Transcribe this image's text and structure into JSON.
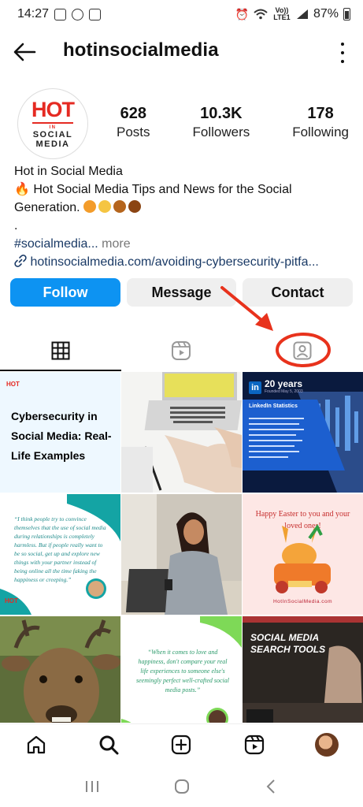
{
  "status_bar": {
    "time": "14:27",
    "network_label": "Vo)) LTE1",
    "battery": "87%"
  },
  "header": {
    "username": "hotinsocialmedia",
    "back_icon": "arrow-left-icon",
    "menu_icon": "kebab-menu-icon"
  },
  "profile": {
    "avatar_logo": {
      "line1": "HOT",
      "line2": "IN",
      "line3": "SOCIAL",
      "line4": "MEDIA"
    },
    "stats": [
      {
        "value": "628",
        "label": "Posts"
      },
      {
        "value": "10.3K",
        "label": "Followers"
      },
      {
        "value": "178",
        "label": "Following"
      }
    ],
    "bio": {
      "name": "Hot in Social Media",
      "line1": "Hot Social Media Tips and News for the Social",
      "line2": "Generation.",
      "line3": ".",
      "hashtag": "#socialmedia...",
      "more": "more",
      "link": "hotinsocialmedia.com/avoiding-cybersecurity-pitfa..."
    }
  },
  "actions": {
    "follow": "Follow",
    "message": "Message",
    "contact": "Contact"
  },
  "tabs": [
    {
      "icon": "grid-icon",
      "active": true
    },
    {
      "icon": "reels-icon",
      "active": false
    },
    {
      "icon": "tagged-icon",
      "active": false
    }
  ],
  "grid": {
    "post1": {
      "logo": "HOT",
      "title": "Cybersecurity in Social Media: Real-Life Examples"
    },
    "post3": {
      "badge": "in",
      "headline": "20 years",
      "sub": "Founded May 5, 2003",
      "card_title": "LinkedIn Statistics"
    },
    "post4": {
      "logo": "HOT",
      "quote": "“I think people try to convince themselves that the use of social media during relationships is completely harmless. But if people really want to be so social, get up and explore new things with your partner instead of being online all the time faking the happiness or creeping.”"
    },
    "post6": {
      "greeting": "Happy Easter to you and your loved ones!",
      "site": "HotInSocialMedia.com"
    },
    "post8": {
      "quote": "“When it comes to love and happiness, don't compare your real life experiences to someone else's seemingly perfect well-crafted social media posts.”"
    },
    "post9": {
      "title": "SOCIAL MEDIA SEARCH TOOLS"
    }
  },
  "bottom_nav": [
    "home-icon",
    "search-icon",
    "create-icon",
    "reels-icon",
    "profile-avatar"
  ],
  "colors": {
    "follow_button": "#0d93f2",
    "secondary_button": "#efefef",
    "annotation": "#e8321c",
    "brand_red": "#e52a22"
  }
}
